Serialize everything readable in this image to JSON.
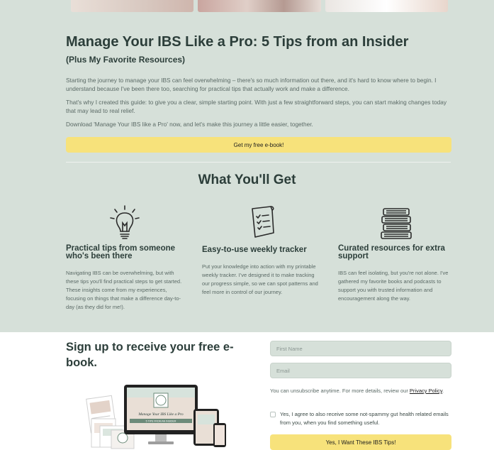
{
  "hero": {
    "title": "Manage Your IBS Like a Pro: 5 Tips from an Insider",
    "subtitle": "(Plus My Favorite Resources)",
    "paragraphs": [
      "Starting the journey to manage your IBS can feel overwhelming – there's so much information out there, and it's hard to know where to begin. I understand because I've been there too, searching for practical tips that actually work and make a difference.",
      "That's why I created this guide: to give you a clear, simple starting point. With just a few straightforward steps, you can start making changes today that may lead to real relief.",
      "Download 'Manage Your IBS like a Pro' now, and let's make this journey a little easier, together."
    ],
    "cta_label": "Get my free e-book!"
  },
  "features": {
    "heading": "What You'll Get",
    "items": [
      {
        "icon": "lightbulb-icon",
        "title": "Practical tips from someone who's been there",
        "text": "Navigating IBS can be overwhelming, but with these tips you'll find practical steps to get started. These insights come from my experiences, focusing on things that make a difference day-to-day (as they did for me!)."
      },
      {
        "icon": "checklist-icon",
        "title": "Easy-to-use weekly tracker",
        "text": "Put your knowledge into action with my printable weekly tracker. I've designed it to make tracking our progress simple, so we can spot patterns and feel more in control of our journey."
      },
      {
        "icon": "books-icon",
        "title": "Curated resources for extra support",
        "text": "IBS can feel isolating, but you're not alone. I've gathered my favorite books and podcasts to support you with trusted information and encouragement along the way."
      }
    ]
  },
  "signup": {
    "title": "Sign up to receive your free e-book.",
    "first_name_placeholder": "First Name",
    "email_placeholder": "Email",
    "note_prefix": "You can unsubscribe anytime. For more details, review our ",
    "privacy_link": "Privacy Policy",
    "note_suffix": ".",
    "consent_label": "Yes, I agree to also receive some not-spammy gut health related emails from you, when you find something useful.",
    "submit_label": "Yes, I Want These IBS Tips!",
    "ebook_cover_title": "Manage Your IBS Like a Pro",
    "ebook_cover_subtitle": "5 TIPS FROM AN INSIDER"
  },
  "colors": {
    "section_bg": "#d6e0d9",
    "accent_yellow": "#f7e27b",
    "heading": "#2c3e3a"
  }
}
